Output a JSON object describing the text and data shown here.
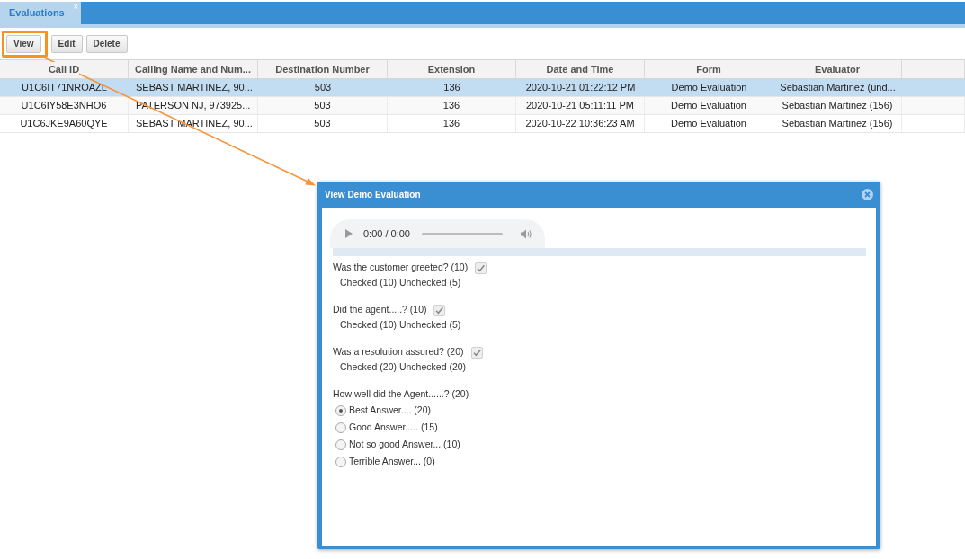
{
  "tab": {
    "label": "Evaluations",
    "close": "×",
    "selected": true
  },
  "toolbar": {
    "buttons": [
      {
        "label": "View",
        "highlighted": true
      },
      {
        "label": "Edit",
        "highlighted": false
      },
      {
        "label": "Delete",
        "highlighted": false
      }
    ]
  },
  "table": {
    "columns": [
      "Call ID",
      "Calling Name and Num...",
      "Destination Number",
      "Extension",
      "Date and Time",
      "Form",
      "Evaluator"
    ],
    "rows": [
      {
        "selected": true,
        "cells": [
          "U1C6IT71NROAZL",
          "SEBAST MARTINEZ, 90...",
          "503",
          "136",
          "2020-10-21 01:22:12 PM",
          "Demo Evaluation",
          "Sebastian Martinez (und..."
        ]
      },
      {
        "selected": false,
        "cells": [
          "U1C6IY58E3NHO6",
          "PATERSON NJ, 973925...",
          "503",
          "136",
          "2020-10-21 05:11:11 PM",
          "Demo Evaluation",
          "Sebastian Martinez (156)"
        ]
      },
      {
        "selected": false,
        "cells": [
          "U1C6JKE9A60QYE",
          "SEBAST MARTINEZ, 90...",
          "503",
          "136",
          "2020-10-22 10:36:23 AM",
          "Demo Evaluation",
          "Sebastian Martinez (156)"
        ]
      }
    ]
  },
  "dialog": {
    "title": "View Demo Evaluation",
    "audio": {
      "time": "0:00 / 0:00"
    },
    "questions": [
      {
        "kind": "checkbox",
        "label": "Was the customer greeted? (10)",
        "checked": true,
        "disabled": true,
        "hint": "Checked (10) Unchecked (5)"
      },
      {
        "kind": "checkbox",
        "label": "Did the agent.....? (10)",
        "checked": true,
        "disabled": true,
        "hint": "Checked (10) Unchecked (5)"
      },
      {
        "kind": "checkbox",
        "label": "Was a resolution assured? (20)",
        "checked": true,
        "disabled": true,
        "hint": "Checked (20) Unchecked (20)"
      },
      {
        "kind": "radio",
        "label": "How well did the Agent......? (20)",
        "options": [
          {
            "label": "Best Answer.... (20)",
            "selected": true
          },
          {
            "label": "Good Answer..... (15)",
            "selected": false
          },
          {
            "label": "Not so good Answer... (10)",
            "selected": false
          },
          {
            "label": "Terrible Answer... (0)",
            "selected": false
          }
        ]
      }
    ]
  }
}
